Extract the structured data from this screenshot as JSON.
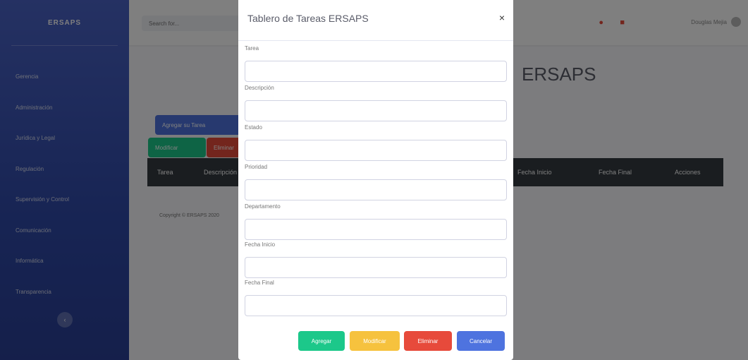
{
  "sidebar": {
    "brand": "ERSAPS",
    "items": [
      {
        "label": "Gerencia"
      },
      {
        "label": "Administración"
      },
      {
        "label": "Jurídica y Legal"
      },
      {
        "label": "Regulación"
      },
      {
        "label": "Supervisión y Control"
      },
      {
        "label": "Comunicación"
      },
      {
        "label": "Informática"
      },
      {
        "label": "Transparencia"
      }
    ],
    "toggle_glyph": "‹"
  },
  "topbar": {
    "search_placeholder": "Search for...",
    "user_name": "Douglas Mejia"
  },
  "main": {
    "title": "ERSAPS",
    "add_button": "Agregar su Tarea",
    "modify_button": "Modificar",
    "delete_button": "Eliminar",
    "table_headers": [
      "Tarea",
      "Descripción",
      "Fecha Inicio",
      "Fecha Final",
      "Acciones"
    ],
    "footer": "Copyright © ERSAPS 2020"
  },
  "modal": {
    "title": "Tablero de Tareas ERSAPS",
    "close": "×",
    "fields": [
      {
        "label": "Tarea"
      },
      {
        "label": "Descripción"
      },
      {
        "label": "Estado"
      },
      {
        "label": "Prioridad"
      },
      {
        "label": "Departamento"
      },
      {
        "label": "Fecha Inicio"
      },
      {
        "label": "Fecha Final"
      }
    ],
    "buttons": {
      "agregar": "Agregar",
      "modificar": "Modificar",
      "eliminar": "Eliminar",
      "cancelar": "Cancelar"
    }
  },
  "colors": {
    "primary": "#4e73df",
    "success": "#1cc88a",
    "warning": "#f6c23e",
    "danger": "#e74a3b",
    "dark": "#343a40"
  }
}
